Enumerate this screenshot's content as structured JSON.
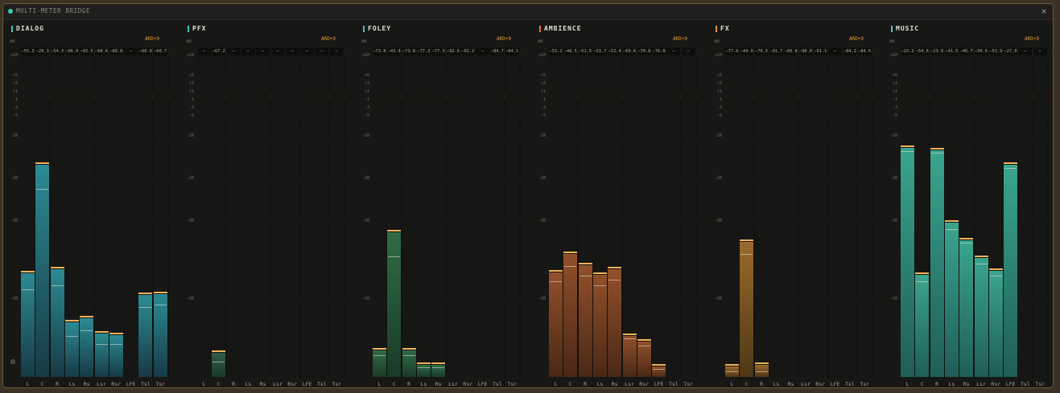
{
  "window": {
    "title": "MULTI-METER BRIDGE",
    "close_label": "×",
    "status_color": "#3fc7b4",
    "settings_icon": "gear-icon",
    "close_icon": "close-icon"
  },
  "scale": {
    "unit": "dB",
    "ticks": [
      "+10",
      "+5",
      "+3",
      "+1",
      "-1",
      "-3",
      "-5",
      "-10",
      "-20",
      "-30",
      "-50"
    ],
    "min_db": -70,
    "max_db": 10,
    "reference_db": 0
  },
  "channels": [
    "L",
    "C",
    "R",
    "Ls",
    "Rs",
    "Lsr",
    "Rsr",
    "LFE",
    "Tsl",
    "Tsr"
  ],
  "panels": [
    {
      "name": "DIALOG",
      "standard": "ARD+9",
      "accent": "#3fc7b4",
      "bar_top": "#2c8b93",
      "bar_bottom": "#173a45",
      "readouts": [
        "−55.3",
        "−28.3",
        "−54.3",
        "−66.0",
        "−65.5",
        "−68.6",
        "−68.8",
        "−",
        "−60.9",
        "−60.7"
      ],
      "meters": [
        {
          "peak": -43.0,
          "rms": -47.5
        },
        {
          "peak": -16.5,
          "rms": -22.5
        },
        {
          "peak": -42.0,
          "rms": -46.5
        },
        {
          "peak": -55.5,
          "rms": -59.5
        },
        {
          "peak": -54.5,
          "rms": -58.0
        },
        {
          "peak": -58.5,
          "rms": -61.5
        },
        {
          "peak": -58.8,
          "rms": -61.5
        },
        null,
        {
          "peak": -48.5,
          "rms": -52.0
        },
        {
          "peak": -48.3,
          "rms": -51.5
        }
      ]
    },
    {
      "name": "PFX",
      "standard": "ARD+9",
      "accent": "#3fc7b4",
      "bar_top": "#2f5e46",
      "bar_bottom": "#1a3a2a",
      "readouts": [
        "−",
        "−67.2",
        "−",
        "−",
        "−",
        "−",
        "−",
        "−",
        "−",
        "−"
      ],
      "meters": [
        null,
        {
          "peak": -63.5,
          "rms": -66.0
        },
        null,
        null,
        null,
        null,
        null,
        null,
        null,
        null
      ]
    },
    {
      "name": "FOLEY",
      "standard": "ARD+9",
      "accent": "#3fc7b4",
      "bar_top": "#2f6c47",
      "bar_bottom": "#1a3a26",
      "readouts": [
        "−73.8",
        "−43.4",
        "−73.8",
        "−77.3",
        "−77.3",
        "−92.6",
        "−92.2",
        "−",
        "−84.7",
        "−84.1"
      ],
      "meters": [
        {
          "peak": -62.8,
          "rms": -64.5
        },
        {
          "peak": -32.5,
          "rms": -39.0
        },
        {
          "peak": -62.8,
          "rms": -64.5
        },
        {
          "peak": -66.5,
          "rms": -67.5
        },
        {
          "peak": -66.5,
          "rms": -67.5
        },
        null,
        null,
        null,
        null,
        null
      ]
    },
    {
      "name": "AMBIENCE",
      "standard": "ARD+9",
      "accent": "#e2753a",
      "bar_top": "#92502a",
      "bar_bottom": "#4a2816",
      "readouts": [
        "−53.2",
        "−48.5",
        "−51.5",
        "−53.7",
        "−52.4",
        "−69.6",
        "−70.8",
        "−76.8",
        "−",
        "−"
      ],
      "meters": [
        {
          "peak": -42.8,
          "rms": -45.5
        },
        {
          "peak": -38.0,
          "rms": -41.5
        },
        {
          "peak": -41.0,
          "rms": -44.0
        },
        {
          "peak": -43.5,
          "rms": -46.5
        },
        {
          "peak": -42.0,
          "rms": -45.0
        },
        {
          "peak": -59.0,
          "rms": -60.0
        },
        {
          "peak": -60.5,
          "rms": -62.0
        },
        {
          "peak": -67.0,
          "rms": -68.0
        },
        null,
        null
      ]
    },
    {
      "name": "FX",
      "standard": "ARD+9",
      "accent": "#e29a3a",
      "bar_top": "#9a6a2a",
      "bar_bottom": "#4e3716",
      "readouts": [
        "−77.6",
        "−44.9",
        "−76.5",
        "−91.7",
        "−89.9",
        "−90.0",
        "−91.1",
        "−",
        "−84.2",
        "−84.5"
      ],
      "meters": [
        {
          "peak": -67.0,
          "rms": -68.5
        },
        {
          "peak": -35.0,
          "rms": -38.5
        },
        {
          "peak": -66.5,
          "rms": -68.5
        },
        null,
        null,
        null,
        null,
        null,
        null,
        null
      ]
    },
    {
      "name": "MUSIC",
      "standard": "ARD+9",
      "accent": "#3fc7b4",
      "bar_top": "#3aa58e",
      "bar_bottom": "#1f5e56",
      "readouts": [
        "−23.2",
        "−54.6",
        "−23.9",
        "−41.5",
        "−46.7",
        "−50.6",
        "−53.9",
        "−27.0",
        "−",
        "−"
      ],
      "meters": [
        {
          "peak": -12.5,
          "rms": -13.5
        },
        {
          "peak": -43.5,
          "rms": -45.5
        },
        {
          "peak": -13.0,
          "rms": -14.0
        },
        {
          "peak": -30.0,
          "rms": -32.0
        },
        {
          "peak": -34.5,
          "rms": -35.5
        },
        {
          "peak": -39.0,
          "rms": -41.0
        },
        {
          "peak": -42.3,
          "rms": -44.0
        },
        {
          "peak": -16.5,
          "rms": -17.5
        },
        null,
        null
      ]
    }
  ]
}
